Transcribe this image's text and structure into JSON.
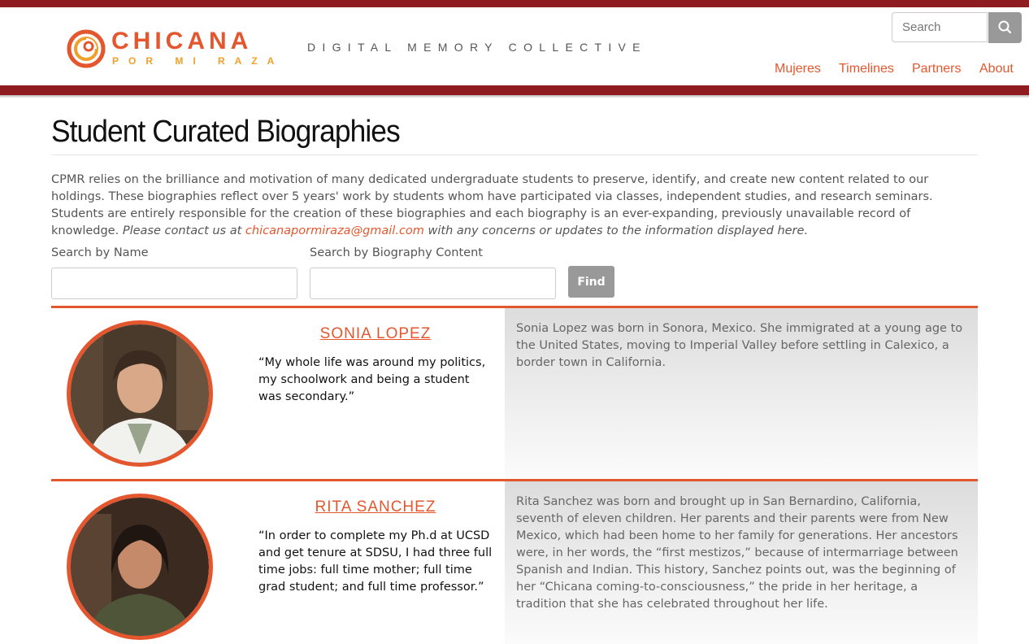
{
  "brand": {
    "title": "CHICANA",
    "subtitle": "POR MI RAZA",
    "tagline": "DIGITAL MEMORY COLLECTIVE",
    "colors": {
      "accent": "#e4572e",
      "maroon": "#8e1b1f",
      "gold": "#f0a02a"
    }
  },
  "search": {
    "placeholder": "Search",
    "icon": "search-icon"
  },
  "nav": {
    "items": [
      {
        "label": "Mujeres"
      },
      {
        "label": "Timelines"
      },
      {
        "label": "Partners"
      },
      {
        "label": "About"
      }
    ]
  },
  "page": {
    "title": "Student Curated Biographies",
    "intro_text": "CPMR relies on the brilliance and motivation of many dedicated undergraduate students to preserve, identify, and create new content related to our holdings. These biographies reflect over 5 years' work by students whom have participated via classes, independent studies, and research seminars. Students are entirely responsible for the creation of these biographies and each biography is an ever-expanding, previously unavailable record of knowledge.",
    "intro_italic_before": "Please contact us at",
    "intro_email": "chicanapormiraza@gmail.com",
    "intro_italic_after": "with any concerns or updates to the information displayed here."
  },
  "filters": {
    "name_label": "Search by Name",
    "name_value": "",
    "content_label": "Search by Biography Content",
    "content_value": "",
    "find_label": "Find"
  },
  "biographies": [
    {
      "name": "SONIA LOPEZ",
      "quote": "“My whole life was around my politics, my schoolwork and being a student was secondary.”",
      "summary": "Sonia Lopez was born in Sonora, Mexico. She immigrated at a young age to the United States, moving to Imperial Valley before settling in Calexico, a border town in California."
    },
    {
      "name": "RITA SANCHEZ",
      "quote": "“In order to complete my Ph.d at UCSD and get tenure at SDSU, I had three full time jobs: full time mother; full time grad student; and full time professor.”",
      "summary": "Rita Sanchez was born and brought up in San Bernardino, California, seventh of eleven children. Her parents and their parents were from New Mexico, which had been home to her family for generations. Her ancestors were, in her words, the “first mestizos,” because of intermarriage between Spanish and Indian. This history, Sanchez points out, was the beginning of her “Chicana coming-to-consciousness,” the pride in her heritage, a tradition that she has celebrated throughout her life."
    }
  ]
}
